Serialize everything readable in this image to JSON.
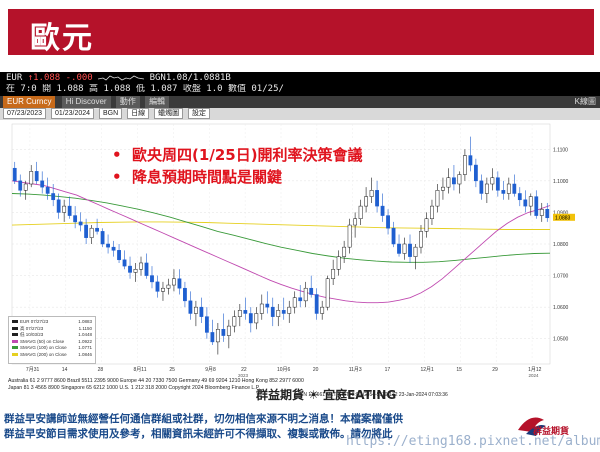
{
  "title": "歐元",
  "quote": {
    "symbol": "EUR",
    "arrow": "↑",
    "price": "1.088",
    "change": "-.000",
    "bid_ask": "BGN1.08/1.0881B",
    "row2": "在 7:0 開 1.088 高 1.088 低 1.087 收盤 1.0 數值 01/25/"
  },
  "toolbar": {
    "security": "EUR Curncy",
    "tab_hidiscover": "Hi Discover",
    "tab_actions": "動作",
    "tab_edit": "編輯",
    "right_label": "K線圖",
    "date_from": "07/23/2023",
    "date_to": "01/23/2024",
    "currency": "BGN",
    "period": "日線",
    "setting1": "蠟燭圖",
    "setting2": "設定"
  },
  "annotations": {
    "bullet_symbol": "•",
    "bullet1": "歐央周四(1/25日)開利率決策會議",
    "bullet2": "降息預期時間點是關鍵"
  },
  "legend": [
    {
      "label": "EUR 07/27/23",
      "value": "1.0883",
      "color": "#222222"
    },
    {
      "label": "高 07/27/23",
      "value": "1.1150",
      "color": "#222222"
    },
    {
      "label": "低 10/03/23",
      "value": "1.0448",
      "color": "#222222"
    },
    {
      "label": "SMAVG (50) on Close",
      "value": "1.0922",
      "color": "#c04ab0"
    },
    {
      "label": "SMAVG (100) on Close",
      "value": "1.0771",
      "color": "#3a9a3a"
    },
    {
      "label": "SMAVG (200) on Close",
      "value": "1.0846",
      "color": "#e6d020"
    }
  ],
  "chart_data": {
    "type": "candlestick",
    "y_ticks": [
      "1.1100",
      "1.1000",
      "1.0900",
      "1.0800",
      "1.0700",
      "1.0600",
      "1.0500"
    ],
    "y_tick_values": [
      1.11,
      1.1,
      1.09,
      1.08,
      1.07,
      1.06,
      1.05
    ],
    "ylim": [
      1.042,
      1.118
    ],
    "last_price_label": "1.0883",
    "x_labels": [
      "7月31",
      "14",
      "28",
      "8月11",
      "25",
      "9月8",
      "22",
      "10月6",
      "20",
      "11月3",
      "17",
      "12月1",
      "15",
      "29",
      "1月12"
    ],
    "x_year_labels": [
      "2023",
      "2024"
    ],
    "candles": [
      {
        "o": 1.104,
        "h": 1.106,
        "l": 1.099,
        "c": 1.1
      },
      {
        "o": 1.1,
        "h": 1.102,
        "l": 1.095,
        "c": 1.097
      },
      {
        "o": 1.097,
        "h": 1.1,
        "l": 1.094,
        "c": 1.099
      },
      {
        "o": 1.099,
        "h": 1.105,
        "l": 1.098,
        "c": 1.103
      },
      {
        "o": 1.103,
        "h": 1.106,
        "l": 1.099,
        "c": 1.1
      },
      {
        "o": 1.1,
        "h": 1.103,
        "l": 1.096,
        "c": 1.098
      },
      {
        "o": 1.098,
        "h": 1.101,
        "l": 1.094,
        "c": 1.096
      },
      {
        "o": 1.096,
        "h": 1.099,
        "l": 1.092,
        "c": 1.094
      },
      {
        "o": 1.094,
        "h": 1.096,
        "l": 1.088,
        "c": 1.09
      },
      {
        "o": 1.09,
        "h": 1.094,
        "l": 1.087,
        "c": 1.092
      },
      {
        "o": 1.092,
        "h": 1.095,
        "l": 1.088,
        "c": 1.089
      },
      {
        "o": 1.089,
        "h": 1.092,
        "l": 1.085,
        "c": 1.087
      },
      {
        "o": 1.087,
        "h": 1.09,
        "l": 1.084,
        "c": 1.086
      },
      {
        "o": 1.086,
        "h": 1.088,
        "l": 1.08,
        "c": 1.082
      },
      {
        "o": 1.082,
        "h": 1.086,
        "l": 1.08,
        "c": 1.085
      },
      {
        "o": 1.085,
        "h": 1.088,
        "l": 1.083,
        "c": 1.084
      },
      {
        "o": 1.084,
        "h": 1.085,
        "l": 1.079,
        "c": 1.08
      },
      {
        "o": 1.08,
        "h": 1.083,
        "l": 1.077,
        "c": 1.079
      },
      {
        "o": 1.079,
        "h": 1.081,
        "l": 1.076,
        "c": 1.078
      },
      {
        "o": 1.078,
        "h": 1.08,
        "l": 1.074,
        "c": 1.075
      },
      {
        "o": 1.075,
        "h": 1.078,
        "l": 1.072,
        "c": 1.073
      },
      {
        "o": 1.073,
        "h": 1.076,
        "l": 1.069,
        "c": 1.071
      },
      {
        "o": 1.071,
        "h": 1.074,
        "l": 1.068,
        "c": 1.072
      },
      {
        "o": 1.072,
        "h": 1.076,
        "l": 1.07,
        "c": 1.074
      },
      {
        "o": 1.074,
        "h": 1.077,
        "l": 1.069,
        "c": 1.07
      },
      {
        "o": 1.07,
        "h": 1.073,
        "l": 1.066,
        "c": 1.068
      },
      {
        "o": 1.068,
        "h": 1.07,
        "l": 1.063,
        "c": 1.065
      },
      {
        "o": 1.065,
        "h": 1.068,
        "l": 1.062,
        "c": 1.066
      },
      {
        "o": 1.066,
        "h": 1.069,
        "l": 1.064,
        "c": 1.067
      },
      {
        "o": 1.067,
        "h": 1.072,
        "l": 1.065,
        "c": 1.069
      },
      {
        "o": 1.069,
        "h": 1.072,
        "l": 1.064,
        "c": 1.066
      },
      {
        "o": 1.066,
        "h": 1.068,
        "l": 1.06,
        "c": 1.062
      },
      {
        "o": 1.062,
        "h": 1.065,
        "l": 1.056,
        "c": 1.058
      },
      {
        "o": 1.058,
        "h": 1.062,
        "l": 1.054,
        "c": 1.06
      },
      {
        "o": 1.06,
        "h": 1.063,
        "l": 1.055,
        "c": 1.057
      },
      {
        "o": 1.057,
        "h": 1.06,
        "l": 1.05,
        "c": 1.052
      },
      {
        "o": 1.052,
        "h": 1.056,
        "l": 1.048,
        "c": 1.049
      },
      {
        "o": 1.049,
        "h": 1.055,
        "l": 1.045,
        "c": 1.053
      },
      {
        "o": 1.053,
        "h": 1.058,
        "l": 1.049,
        "c": 1.051
      },
      {
        "o": 1.051,
        "h": 1.056,
        "l": 1.047,
        "c": 1.054
      },
      {
        "o": 1.054,
        "h": 1.059,
        "l": 1.052,
        "c": 1.057
      },
      {
        "o": 1.057,
        "h": 1.061,
        "l": 1.054,
        "c": 1.059
      },
      {
        "o": 1.059,
        "h": 1.063,
        "l": 1.056,
        "c": 1.058
      },
      {
        "o": 1.058,
        "h": 1.06,
        "l": 1.052,
        "c": 1.055
      },
      {
        "o": 1.055,
        "h": 1.06,
        "l": 1.053,
        "c": 1.058
      },
      {
        "o": 1.058,
        "h": 1.064,
        "l": 1.056,
        "c": 1.061
      },
      {
        "o": 1.061,
        "h": 1.065,
        "l": 1.058,
        "c": 1.06
      },
      {
        "o": 1.06,
        "h": 1.063,
        "l": 1.054,
        "c": 1.057
      },
      {
        "o": 1.057,
        "h": 1.061,
        "l": 1.054,
        "c": 1.059
      },
      {
        "o": 1.059,
        "h": 1.063,
        "l": 1.056,
        "c": 1.058
      },
      {
        "o": 1.058,
        "h": 1.062,
        "l": 1.055,
        "c": 1.06
      },
      {
        "o": 1.06,
        "h": 1.065,
        "l": 1.058,
        "c": 1.063
      },
      {
        "o": 1.063,
        "h": 1.067,
        "l": 1.06,
        "c": 1.062
      },
      {
        "o": 1.062,
        "h": 1.068,
        "l": 1.06,
        "c": 1.066
      },
      {
        "o": 1.066,
        "h": 1.07,
        "l": 1.063,
        "c": 1.064
      },
      {
        "o": 1.064,
        "h": 1.066,
        "l": 1.056,
        "c": 1.058
      },
      {
        "o": 1.058,
        "h": 1.062,
        "l": 1.056,
        "c": 1.06
      },
      {
        "o": 1.06,
        "h": 1.07,
        "l": 1.059,
        "c": 1.069
      },
      {
        "o": 1.069,
        "h": 1.075,
        "l": 1.067,
        "c": 1.072
      },
      {
        "o": 1.072,
        "h": 1.078,
        "l": 1.07,
        "c": 1.076
      },
      {
        "o": 1.076,
        "h": 1.081,
        "l": 1.074,
        "c": 1.079
      },
      {
        "o": 1.079,
        "h": 1.088,
        "l": 1.077,
        "c": 1.086
      },
      {
        "o": 1.086,
        "h": 1.09,
        "l": 1.082,
        "c": 1.088
      },
      {
        "o": 1.088,
        "h": 1.094,
        "l": 1.086,
        "c": 1.092
      },
      {
        "o": 1.092,
        "h": 1.098,
        "l": 1.09,
        "c": 1.095
      },
      {
        "o": 1.095,
        "h": 1.101,
        "l": 1.093,
        "c": 1.097
      },
      {
        "o": 1.097,
        "h": 1.1,
        "l": 1.09,
        "c": 1.092
      },
      {
        "o": 1.092,
        "h": 1.096,
        "l": 1.087,
        "c": 1.089
      },
      {
        "o": 1.089,
        "h": 1.091,
        "l": 1.083,
        "c": 1.085
      },
      {
        "o": 1.085,
        "h": 1.087,
        "l": 1.079,
        "c": 1.08
      },
      {
        "o": 1.08,
        "h": 1.083,
        "l": 1.076,
        "c": 1.077
      },
      {
        "o": 1.077,
        "h": 1.082,
        "l": 1.075,
        "c": 1.08
      },
      {
        "o": 1.08,
        "h": 1.083,
        "l": 1.074,
        "c": 1.076
      },
      {
        "o": 1.076,
        "h": 1.08,
        "l": 1.072,
        "c": 1.079
      },
      {
        "o": 1.079,
        "h": 1.086,
        "l": 1.077,
        "c": 1.084
      },
      {
        "o": 1.084,
        "h": 1.09,
        "l": 1.082,
        "c": 1.088
      },
      {
        "o": 1.088,
        "h": 1.094,
        "l": 1.086,
        "c": 1.092
      },
      {
        "o": 1.092,
        "h": 1.099,
        "l": 1.09,
        "c": 1.097
      },
      {
        "o": 1.097,
        "h": 1.101,
        "l": 1.094,
        "c": 1.098
      },
      {
        "o": 1.098,
        "h": 1.104,
        "l": 1.096,
        "c": 1.101
      },
      {
        "o": 1.101,
        "h": 1.105,
        "l": 1.097,
        "c": 1.099
      },
      {
        "o": 1.099,
        "h": 1.103,
        "l": 1.096,
        "c": 1.102
      },
      {
        "o": 1.102,
        "h": 1.11,
        "l": 1.1,
        "c": 1.108
      },
      {
        "o": 1.108,
        "h": 1.114,
        "l": 1.103,
        "c": 1.105
      },
      {
        "o": 1.105,
        "h": 1.107,
        "l": 1.098,
        "c": 1.1
      },
      {
        "o": 1.1,
        "h": 1.102,
        "l": 1.094,
        "c": 1.096
      },
      {
        "o": 1.096,
        "h": 1.101,
        "l": 1.093,
        "c": 1.099
      },
      {
        "o": 1.099,
        "h": 1.104,
        "l": 1.097,
        "c": 1.101
      },
      {
        "o": 1.101,
        "h": 1.103,
        "l": 1.095,
        "c": 1.097
      },
      {
        "o": 1.097,
        "h": 1.1,
        "l": 1.094,
        "c": 1.096
      },
      {
        "o": 1.096,
        "h": 1.101,
        "l": 1.094,
        "c": 1.099
      },
      {
        "o": 1.099,
        "h": 1.102,
        "l": 1.095,
        "c": 1.096
      },
      {
        "o": 1.096,
        "h": 1.098,
        "l": 1.092,
        "c": 1.094
      },
      {
        "o": 1.094,
        "h": 1.097,
        "l": 1.09,
        "c": 1.092
      },
      {
        "o": 1.092,
        "h": 1.096,
        "l": 1.089,
        "c": 1.095
      },
      {
        "o": 1.095,
        "h": 1.097,
        "l": 1.088,
        "c": 1.089
      },
      {
        "o": 1.089,
        "h": 1.093,
        "l": 1.087,
        "c": 1.091
      },
      {
        "o": 1.091,
        "h": 1.093,
        "l": 1.087,
        "c": 1.0883
      }
    ],
    "sma50": [
      1.1,
      1.0995,
      1.099,
      1.0985,
      1.0975,
      1.0965,
      1.0955,
      1.094,
      1.0925,
      1.091,
      1.0895,
      1.088,
      1.0865,
      1.085,
      1.0835,
      1.082,
      1.0805,
      1.079,
      1.0775,
      1.076,
      1.0745,
      1.073,
      1.0715,
      1.07,
      1.0685,
      1.0672,
      1.066,
      1.065,
      1.064,
      1.0632,
      1.0626,
      1.062,
      1.0616,
      1.0614,
      1.0614,
      1.0616,
      1.0622,
      1.063,
      1.0645,
      1.0665,
      1.069,
      1.072,
      1.075,
      1.078,
      1.081,
      1.084,
      1.0865,
      1.0885,
      1.09,
      1.091,
      1.0922
    ],
    "sma100": [
      1.096,
      1.0958,
      1.0955,
      1.095,
      1.0945,
      1.0938,
      1.093,
      1.092,
      1.091,
      1.0898,
      1.0885,
      1.087,
      1.0855,
      1.084,
      1.0828,
      1.0815,
      1.0802,
      1.079,
      1.078,
      1.077,
      1.0762,
      1.0755,
      1.075,
      1.0746,
      1.0743,
      1.0742,
      1.0742,
      1.0744,
      1.0748,
      1.0753,
      1.0758,
      1.0763,
      1.0767,
      1.077,
      1.0771
    ],
    "sma200": [
      1.086,
      1.0862,
      1.0864,
      1.0866,
      1.0868,
      1.0869,
      1.087,
      1.087,
      1.0869,
      1.0868,
      1.0866,
      1.0864,
      1.0862,
      1.086,
      1.0858,
      1.0856,
      1.0854,
      1.0852,
      1.0851,
      1.085,
      1.0849,
      1.0848,
      1.0847,
      1.0846,
      1.0846,
      1.0846
    ]
  },
  "bottom_line1": "Australia 61 2 9777 8600  Brazil 5511 2395 9000  Europe 44 20 7330 7500  Germany 49 69 9204 1210  Hong Kong 852 2977 6000",
  "bottom_line2": "Japan 81 3 4565 8900  Singapore 65 6212 1000  U.S. 1 212 318 2000  Copyright 2024 Bloomberg Finance L.P.",
  "bottom_line3": "SN 126661 M1T GMT+8:00 G454-5119-172 23-Jan-2024 07:03:36",
  "footer": {
    "disclaimer_line1": "群益早安講師並無經營任何通信群組或社群，切勿相信來源不明之消息！本檔案檔僅供",
    "disclaimer_line2": "群益早安節目需求使用及參考，相關資訊未經許可不得擷取、複製或散佈。請勿將此",
    "mid_logo": "群益期貨 ☀ 宜庭EATING",
    "watermark": "https://eting168.pixnet.net/album",
    "brand": "群益期貨"
  }
}
